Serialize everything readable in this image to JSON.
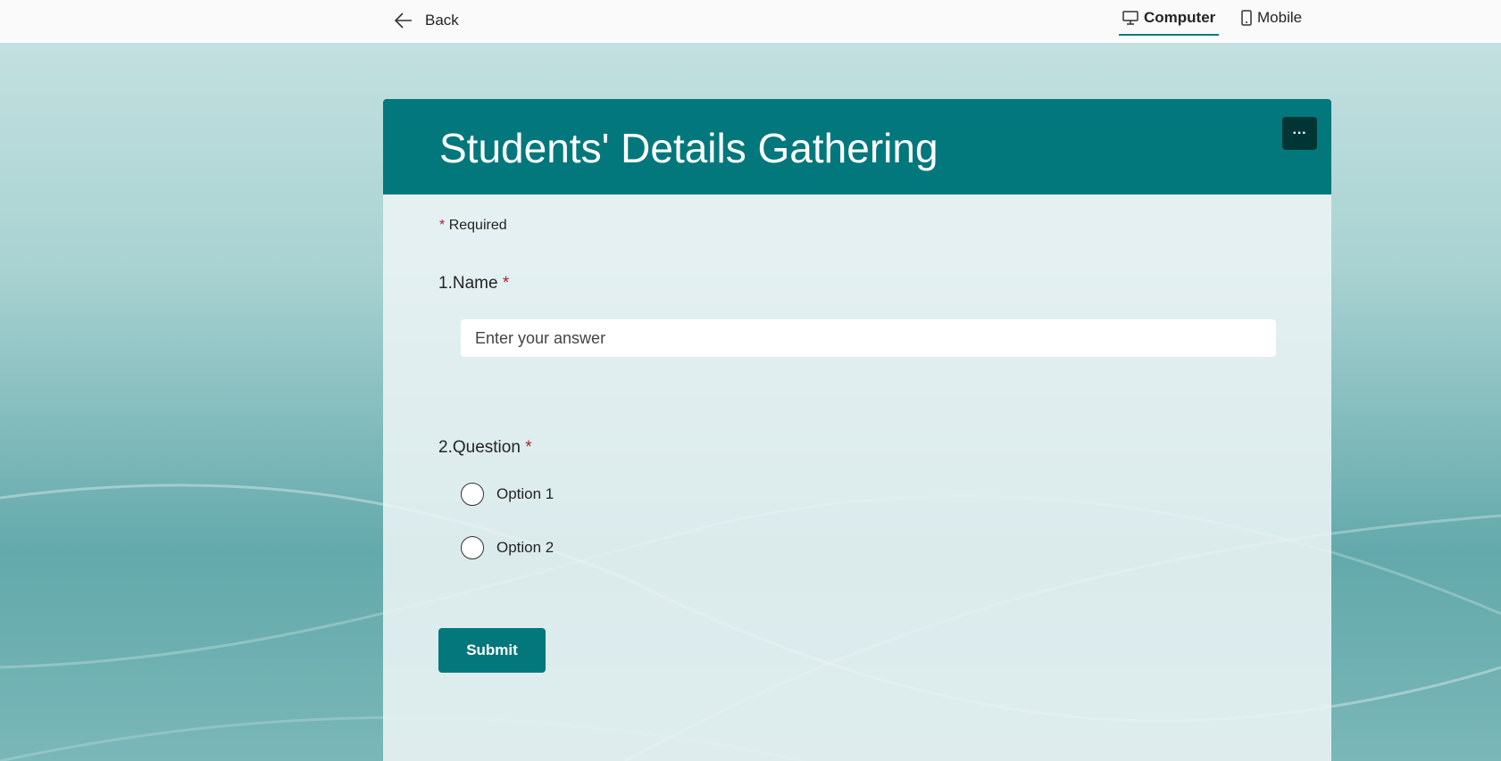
{
  "topbar": {
    "back_label": "Back",
    "tabs": [
      {
        "label": "Computer",
        "active": true
      },
      {
        "label": "Mobile",
        "active": false
      }
    ]
  },
  "form": {
    "title": "Students' Details Gathering",
    "more_label": "···",
    "required_note": "Required",
    "required_marker": "*",
    "questions": [
      {
        "number": "1.",
        "label": "Name",
        "placeholder": "Enter your answer"
      },
      {
        "number": "2.",
        "label": "Question",
        "options": [
          "Option 1",
          "Option 2"
        ]
      }
    ],
    "submit_label": "Submit"
  },
  "colors": {
    "accent": "#03787c",
    "required": "#a4262c"
  }
}
